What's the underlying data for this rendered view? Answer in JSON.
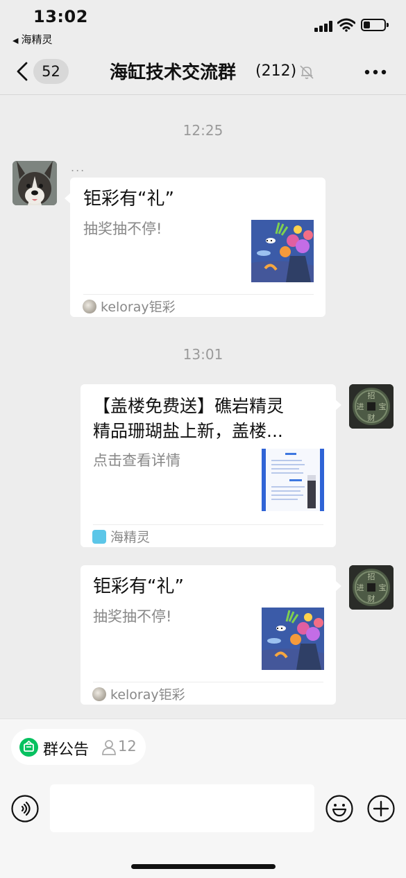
{
  "status_bar": {
    "time": "13:02",
    "back_app": "海精灵"
  },
  "nav": {
    "unread_count": "52",
    "title": "海缸技术交流群",
    "member_count": "(212)"
  },
  "messages": [
    {
      "timestamp": "12:25"
    },
    {
      "sender_name": "...",
      "title": "钜彩有“礼”",
      "desc": "抽奖抽不停!",
      "source": "keloray钜彩"
    },
    {
      "timestamp": "13:01"
    },
    {
      "title_line1": "【盖楼免费送】礁岩精灵",
      "title_line2": "精品珊瑚盐上新，盖楼...",
      "desc": "点击查看详情",
      "source": "海精灵"
    },
    {
      "title": "钜彩有“礼”",
      "desc": "抽奖抽不停!",
      "source": "keloray钜彩"
    }
  ],
  "bottom": {
    "notice_label": "群公告",
    "notice_count": "12",
    "input_placeholder": ""
  },
  "colors": {
    "accent": "#07c160",
    "background": "#ededed",
    "bubble": "#ffffff"
  }
}
